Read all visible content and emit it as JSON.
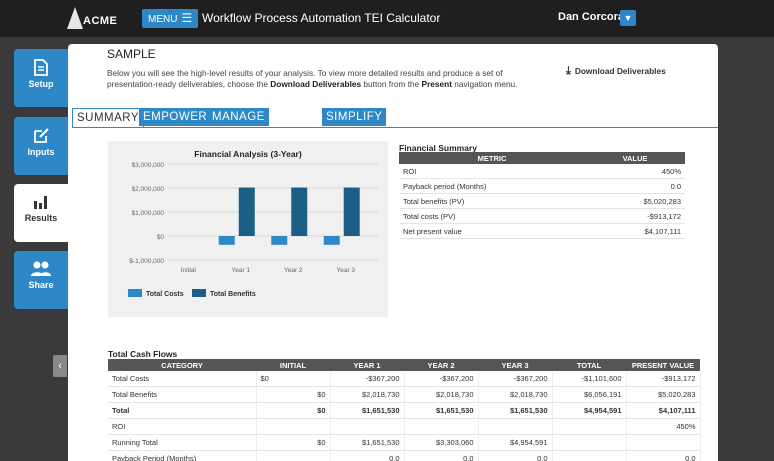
{
  "header": {
    "logo_text": "ACME",
    "menu_label": "MENU",
    "app_title": "Workflow Process Automation TEI Calculator",
    "user_name": "Dan Corcoran",
    "user_caret": "▼"
  },
  "sidebar": {
    "items": [
      {
        "label": "Setup",
        "icon": "document-icon"
      },
      {
        "label": "Inputs",
        "icon": "edit-icon"
      },
      {
        "label": "Results",
        "icon": "bar-chart-icon"
      },
      {
        "label": "Share",
        "icon": "users-icon"
      }
    ],
    "active": "Results",
    "collapse_glyph": "‹"
  },
  "content": {
    "heading": "SAMPLE",
    "description_1": "Below you will see the high-level results of your analysis. To view more detailed results and produce a set of presentation-ready deliverables, choose the ",
    "description_bold_1": "Download Deliverables",
    "description_2": " button from the ",
    "description_bold_2": "Present",
    "description_3": " navigation menu.",
    "download_label": "Download Deliverables"
  },
  "tabs": [
    "SUMMARY",
    "EMPOWER",
    "MANAGE & SECURE",
    "SIMPLIFY"
  ],
  "active_tab": "SUMMARY",
  "chart_data": {
    "type": "bar",
    "title": "Financial Analysis (3-Year)",
    "categories": [
      "Initial",
      "Year 1",
      "Year 2",
      "Year 3"
    ],
    "series": [
      {
        "name": "Total Costs",
        "values": [
          0,
          -367200,
          -367200,
          -367200
        ],
        "color": "#2e88c8"
      },
      {
        "name": "Total Benefits",
        "values": [
          0,
          2018730,
          2018730,
          2018730
        ],
        "color": "#1c5e86"
      }
    ],
    "y_ticks": [
      "$3,000,000",
      "$2,000,000",
      "$1,000,000",
      "$0",
      "$-1,000,000"
    ],
    "y_tick_values": [
      3000000,
      2000000,
      1000000,
      0,
      -1000000
    ],
    "ylim": [
      -1000000,
      3000000
    ],
    "legend": "bottom-left"
  },
  "financial_summary": {
    "title": "Financial Summary",
    "headers": [
      "METRIC",
      "VALUE"
    ],
    "rows": [
      [
        "ROI",
        "450%"
      ],
      [
        "Payback period (Months)",
        "0.0"
      ],
      [
        "Total benefits (PV)",
        "$5,020,283"
      ],
      [
        "Total costs (PV)",
        "-$913,172"
      ],
      [
        "Net present value",
        "$4,107,111"
      ]
    ]
  },
  "total_cash_flows": {
    "title": "Total Cash Flows",
    "headers": [
      "CATEGORY",
      "INITIAL",
      "YEAR 1",
      "YEAR 2",
      "YEAR 3",
      "TOTAL",
      "PRESENT VALUE"
    ],
    "rows": [
      {
        "cells": [
          "Total Costs",
          "$0",
          "-$367,200",
          "-$367,200",
          "-$367,200",
          "-$1,101,600",
          "-$913,172"
        ],
        "bold": false
      },
      {
        "cells": [
          "Total Benefits",
          "$0",
          "$2,018,730",
          "$2,018,730",
          "$2,018,730",
          "$6,056,191",
          "$5,020,283"
        ],
        "bold": false
      },
      {
        "cells": [
          "Total",
          "$0",
          "$1,651,530",
          "$1,651,530",
          "$1,651,530",
          "$4,954,591",
          "$4,107,111"
        ],
        "bold": true
      },
      {
        "cells": [
          "ROI",
          "",
          "",
          "",
          "",
          "",
          "450%"
        ],
        "bold": false
      },
      {
        "cells": [
          "Running Total",
          "$0",
          "$1,651,530",
          "$3,303,060",
          "$4,954,591",
          "",
          ""
        ],
        "bold": false
      },
      {
        "cells": [
          "Payback Period (Months)",
          "",
          "0.0",
          "0.0",
          "0.0",
          "",
          "0.0"
        ],
        "bold": false
      }
    ]
  }
}
